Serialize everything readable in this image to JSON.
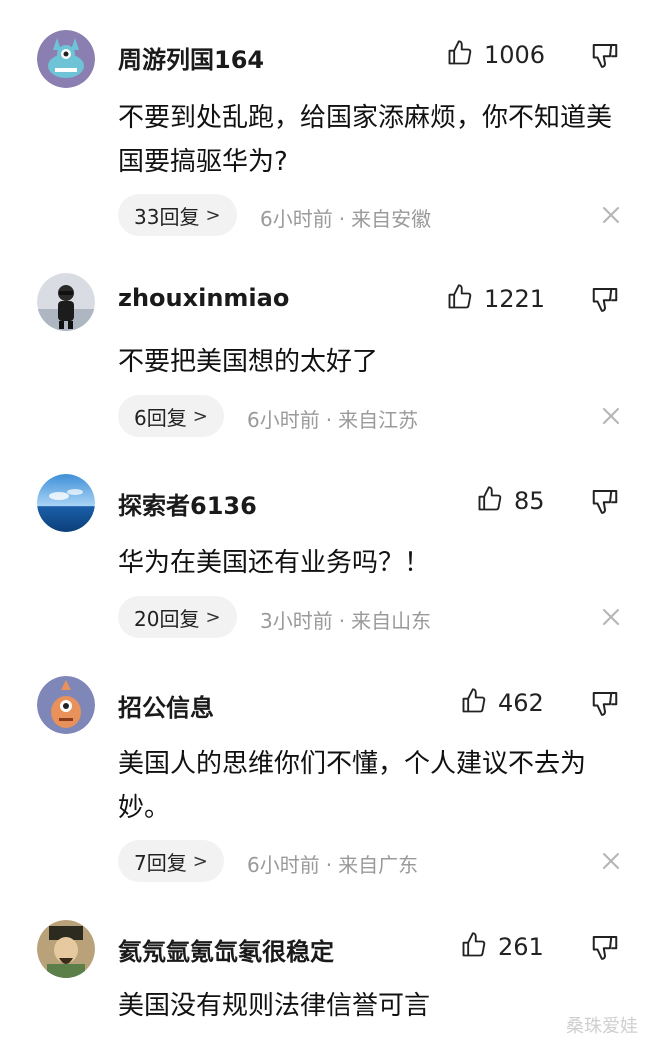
{
  "comments": [
    {
      "username": "周游列国164",
      "likes": "1006",
      "content": "不要到处乱跑，给国家添麻烦，你不知道美国要搞驱华为?",
      "replies": "33回复",
      "time": "6小时前",
      "location": "来自安徽",
      "avatar_icon": "monster-avatar"
    },
    {
      "username": "zhouxinmiao",
      "likes": "1221",
      "content": "不要把美国想的太好了",
      "replies": "6回复",
      "time": "6小时前",
      "location": "来自江苏",
      "avatar_icon": "person-photo-avatar"
    },
    {
      "username": "探索者6136",
      "likes": "85",
      "content": "华为在美国还有业务吗？！",
      "replies": "20回复",
      "time": "3小时前",
      "location": "来自山东",
      "avatar_icon": "ocean-sky-avatar"
    },
    {
      "username": "招公信息",
      "likes": "462",
      "content": "美国人的思维你们不懂，个人建议不去为妙。",
      "replies": "7回复",
      "time": "6小时前",
      "location": "来自广东",
      "avatar_icon": "cartoon-creature-avatar"
    },
    {
      "username": "氦氖氩氪氙氡很稳定",
      "likes": "261",
      "content": "美国没有规则法律信誉可言",
      "replies": "",
      "time": "",
      "location": "",
      "avatar_icon": "portrait-painting-avatar"
    }
  ],
  "meta_separator": "·",
  "reply_chevron": ">",
  "watermark": "桑珠爱娃",
  "colors": {
    "meta_gray": "#9a9a9a",
    "pill_bg": "#f2f2f2",
    "text": "#111111"
  }
}
